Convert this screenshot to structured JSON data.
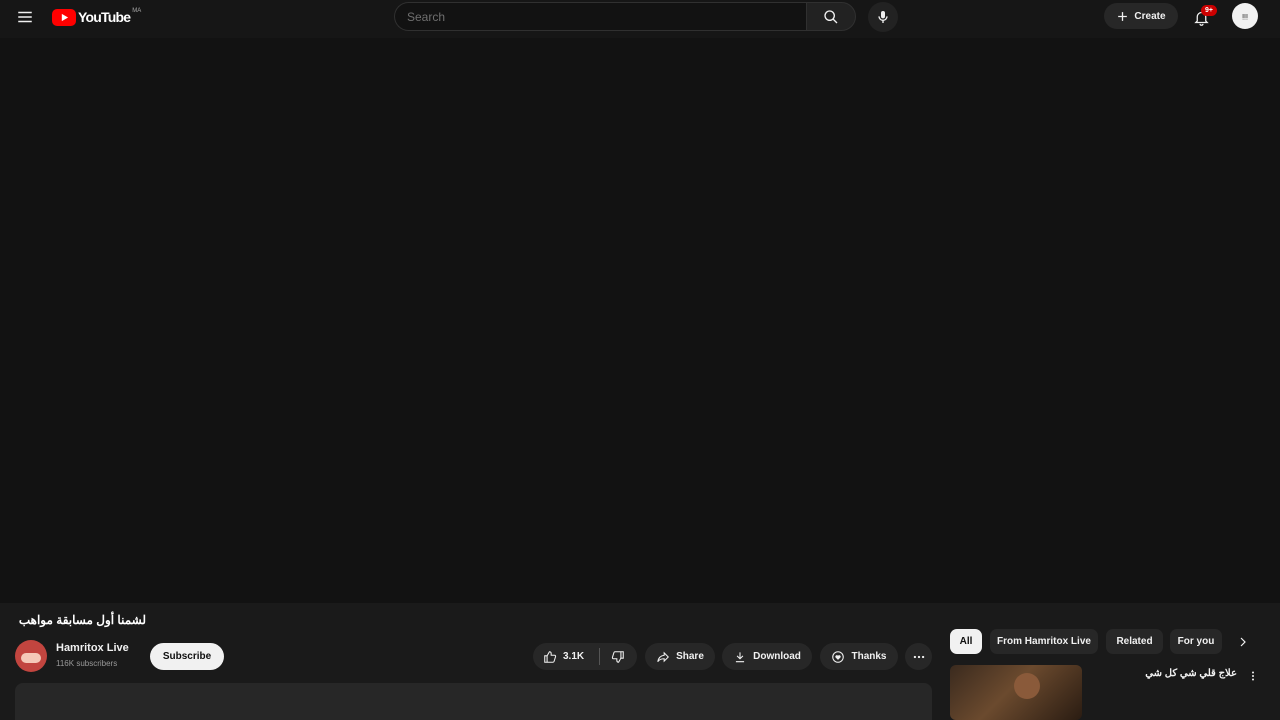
{
  "masthead": {
    "logo_text": "YouTube",
    "country_code": "MA",
    "search_placeholder": "Search",
    "create_label": "Create",
    "notification_count": "9+",
    "avatar_text": "ᴉᴉᴉ"
  },
  "video": {
    "title": "لشمنا أول مسابقة مواهب",
    "channel": {
      "name": "Hamritox Live",
      "subscribers": "116K subscribers"
    },
    "subscribe_label": "Subscribe",
    "actions": {
      "like_count": "3.1K",
      "share_label": "Share",
      "download_label": "Download",
      "thanks_label": "Thanks"
    }
  },
  "chips": {
    "all": "All",
    "from_channel": "From Hamritox Live",
    "related": "Related",
    "for_you": "For you"
  },
  "recommendation": {
    "title": "علاج قلي شي كل شي"
  },
  "colors": {
    "brand": "#ff0000",
    "background": "#0f0f0f",
    "surface": "#272727",
    "badge": "#cc0000"
  },
  "icons": {
    "menu": "hamburger-menu-icon",
    "search": "search-icon",
    "mic": "microphone-icon",
    "create": "plus-icon",
    "notifications": "bell-icon",
    "like": "thumbs-up-icon",
    "dislike": "thumbs-down-icon",
    "share": "share-arrow-icon",
    "download": "download-icon",
    "thanks": "thanks-heart-icon",
    "more": "more-horizontal-icon"
  }
}
